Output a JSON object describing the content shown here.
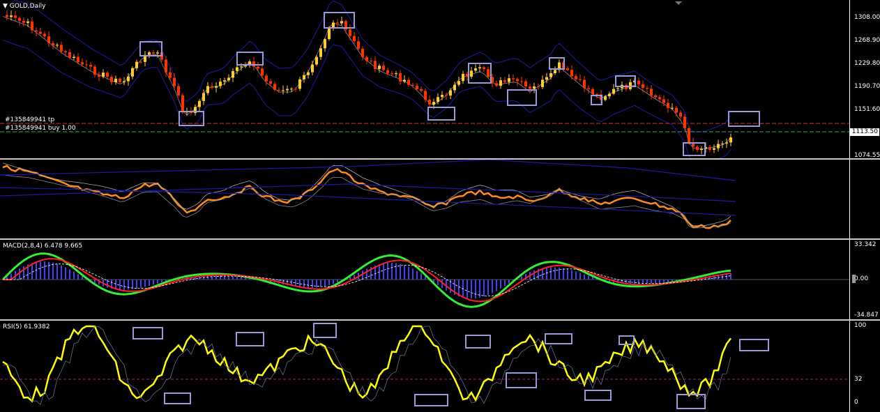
{
  "main": {
    "symbol": "GOLD,Daily",
    "order_tp": "#135849941 tp",
    "order_buy": "#135849941 buy 1.00",
    "current_price": "1113.50",
    "ticks": [
      "1308.00",
      "1268.90",
      "1229.80",
      "1190.70",
      "1151.60",
      "1074.55"
    ]
  },
  "macd": {
    "label": "MACD(2,8,4) 6.478 9.665",
    "ticks": [
      "33.342",
      "0.00",
      "-34.847"
    ]
  },
  "rsi": {
    "label": "RSI(5) 61.9382",
    "ticks": [
      "100",
      "32",
      "0"
    ]
  },
  "colors": {
    "bull": "#ffcc33",
    "bear": "#ff3300",
    "band": "#1a1aa8",
    "orange": "#ff8c1a",
    "macd_main": "#33ee33",
    "macd_signal": "#ff2020",
    "macd_hist": "#4040ff",
    "rsi": "#ffff00",
    "box": "#9a9ad8"
  }
}
